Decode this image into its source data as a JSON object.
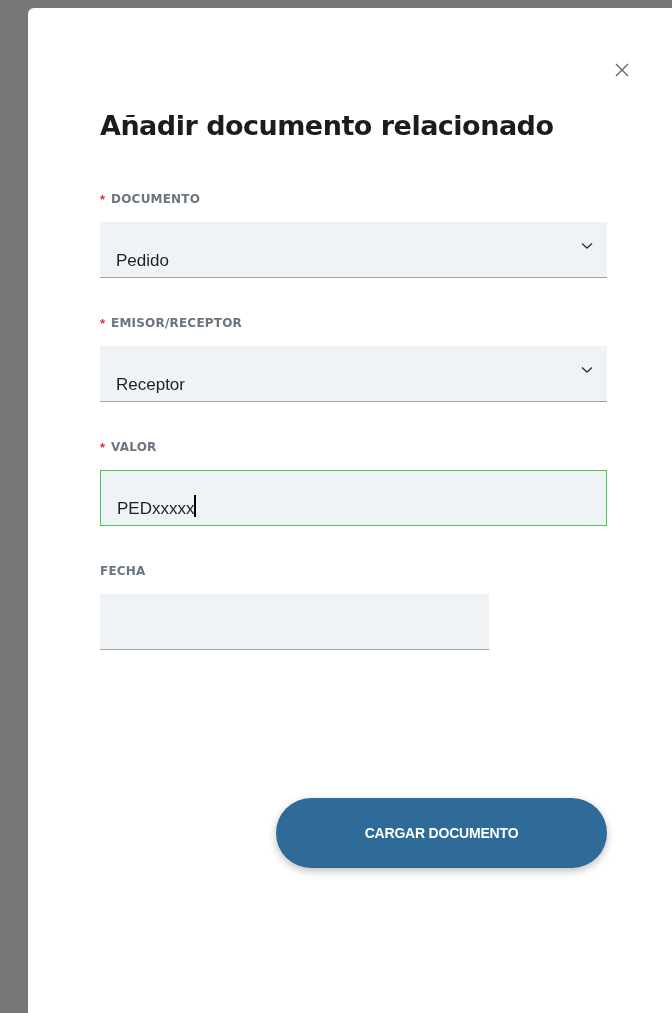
{
  "dialog": {
    "title": "Añadir documento relacionado"
  },
  "fields": [
    {
      "kind": "select",
      "label": "DOCUMENTO",
      "required_mark": "*",
      "required": true,
      "value": "Pedido",
      "focused": false,
      "wide": true
    },
    {
      "kind": "select",
      "label": "EMISOR/RECEPTOR",
      "required_mark": "*",
      "required": true,
      "value": "Receptor",
      "focused": false,
      "wide": true
    },
    {
      "kind": "text",
      "label": "VALOR",
      "required_mark": "*",
      "required": true,
      "value": "PEDxxxxx",
      "focused": true,
      "wide": true
    },
    {
      "kind": "date",
      "label": "FECHA",
      "required": false,
      "focused": false,
      "wide": false
    }
  ],
  "submit_button": {
    "label": "CARGAR DOCUMENTO"
  }
}
